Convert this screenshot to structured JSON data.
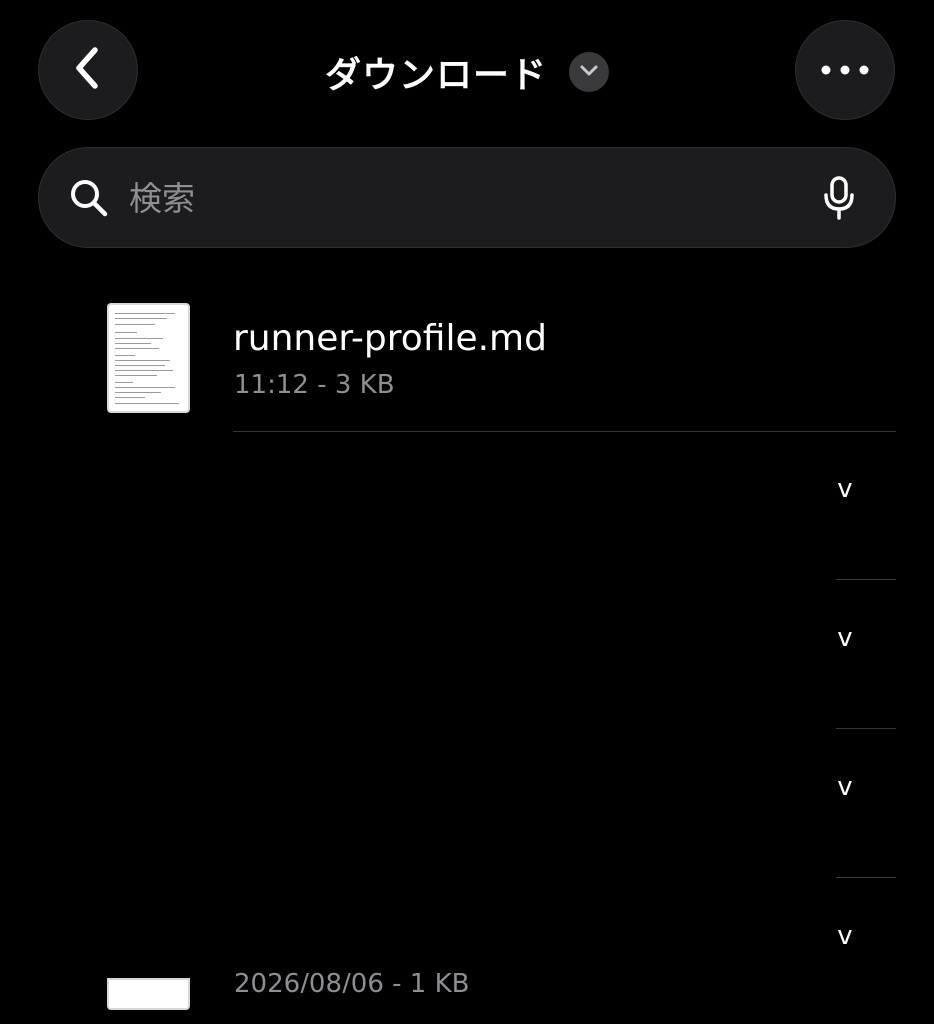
{
  "header": {
    "title": "ダウンロード",
    "back_icon": "chevron-left-icon",
    "title_menu_icon": "chevron-down-icon",
    "more_icon": "ellipsis-icon"
  },
  "search": {
    "placeholder": "検索",
    "value": "",
    "mic_icon": "microphone-icon"
  },
  "files": [
    {
      "name": "runner-profile.md",
      "meta": "11:12 - 3 KB"
    },
    {
      "name": "",
      "meta": "2026/08/06 - 1 KB"
    }
  ],
  "row_chevrons": [
    "v",
    "v",
    "v",
    "v"
  ],
  "colors": {
    "background": "#000000",
    "control_fill": "#1c1c1e",
    "secondary_text": "#8e8e93",
    "separator": "#38383a"
  }
}
